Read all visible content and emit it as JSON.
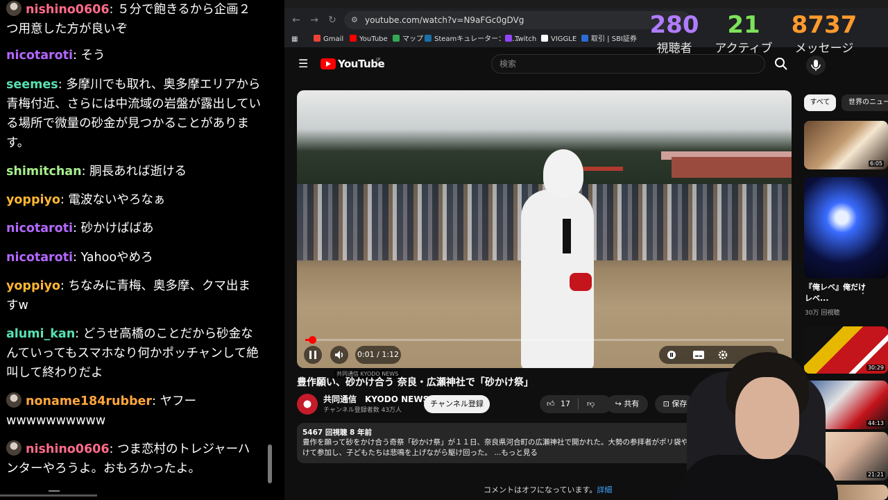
{
  "chat": {
    "messages": [
      {
        "user": "nishino0606",
        "text": "５分で飽きるから企画２つ用意した方が良いぞ",
        "color": "#ff6b8a",
        "avatar": true
      },
      {
        "user": "nicotaroti",
        "text": "そう",
        "color": "#b368ff",
        "avatar": false
      },
      {
        "user": "seemes",
        "text": "多摩川でも取れ、奥多摩エリアから青梅付近、さらには中流域の岩盤が露出している場所で微量の砂金が見つかることがあります。",
        "color": "#58e0b0",
        "avatar": false
      },
      {
        "user": "shimitchan",
        "text": "胴長あれば逝ける",
        "color": "#a6ef8d",
        "avatar": false
      },
      {
        "user": "yoppiyo",
        "text": "電波ないやろなぁ",
        "color": "#ffb733",
        "avatar": false
      },
      {
        "user": "nicotaroti",
        "text": "砂かけばばあ",
        "color": "#b368ff",
        "avatar": false
      },
      {
        "user": "nicotaroti",
        "text": "Yahooやめろ",
        "color": "#b368ff",
        "avatar": false
      },
      {
        "user": "yoppiyo",
        "text": "ちなみに青梅、奥多摩、クマ出ますw",
        "color": "#ffb733",
        "avatar": false
      },
      {
        "user": "alumi_kan",
        "text": "どうせ高橋のことだから砂金なんていってもスマホなり何かポッチャンして絶叫して終わりだよ",
        "color": "#58e0b0",
        "avatar": false
      },
      {
        "user": "noname184rubber",
        "text": "ヤフーwwwwwwwwww",
        "color": "#ffa63d",
        "avatar": true
      },
      {
        "user": "nishino0606",
        "text": "つま恋村のトレジャーハンターやろうよ。おもろかったよ。",
        "color": "#ff6b8a",
        "avatar": true
      }
    ]
  },
  "stats": {
    "viewers": {
      "value": "280",
      "label": "視聴者",
      "color": "#b07cff"
    },
    "active": {
      "value": "21",
      "label": "アクティブ",
      "color": "#7de35a"
    },
    "messages": {
      "value": "8737",
      "label": "メッセージ",
      "color": "#ff9a2e"
    }
  },
  "browser": {
    "url": "youtube.com/watch?v=N9aFGc0gDVg",
    "bookmarks": [
      {
        "label": "Gmail",
        "color": "#ea4335"
      },
      {
        "label": "YouTube",
        "color": "#ff0000"
      },
      {
        "label": "マップ",
        "color": "#34a853"
      },
      {
        "label": "Steamキュレーター：収...",
        "color": "#1b6fa8"
      },
      {
        "label": "Twitch",
        "color": "#9146ff"
      },
      {
        "label": "VIGGLE",
        "color": "#ffffff"
      },
      {
        "label": "取引 | SBI証券",
        "color": "#2b6cd4"
      }
    ]
  },
  "youtube": {
    "logo_text": "YouTube",
    "logo_region": "JP",
    "search_placeholder": "検索",
    "video": {
      "time": "0:01 / 1:12",
      "progress": 0.014,
      "title": "豊作願い、砂かけ合う 奈良・広瀬神社で「砂かけ祭」",
      "watermark": "共同通信 KYODO NEWS"
    },
    "channel": {
      "name": "共同通信　KYODO NEWS",
      "subs": "チャンネル登録者数 43万人",
      "subscribe_label": "チャンネル登録"
    },
    "actions": {
      "likes": "17",
      "share": "共有",
      "save": "保存"
    },
    "description": {
      "meta": "5467 回視聴  8 年前",
      "text": "豊作を願って砂をかけ合う奇祭「砂かけ祭」が１１日、奈良県河合町の広瀬神社で開かれた。大勢の参拝者がポリ袋やゴー…着けて参加し、子どもたちは悲鳴を上げながら駆け回った。 ...もっと見る"
    },
    "comments_off": "コメントはオフになっています。",
    "comments_link": "詳細",
    "chips": [
      "すべて",
      "世界のニュース"
    ],
    "recommendations": [
      {
        "duration": "6:05",
        "title": "",
        "meta": ""
      },
      {
        "duration": "",
        "title": "『俺レベ』俺だけレベ...",
        "meta": "30万 回視聴"
      },
      {
        "duration": "30:29",
        "title": "",
        "meta": ""
      },
      {
        "duration": "44:13",
        "title": "",
        "meta": ""
      },
      {
        "duration": "21:21",
        "title": "",
        "meta": ""
      }
    ]
  }
}
